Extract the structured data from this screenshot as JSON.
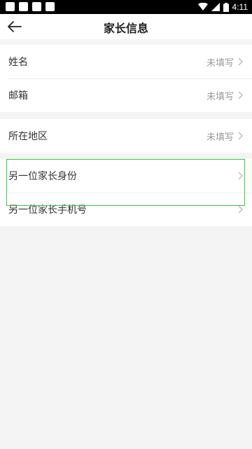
{
  "status_bar": {
    "time": "4:11",
    "icons": [
      "notification-icon",
      "notification-icon",
      "notification-icon",
      "notification-icon",
      "wifi-icon",
      "signal-icon",
      "battery-icon"
    ]
  },
  "header": {
    "title": "家长信息",
    "back_icon": "arrow-left-icon"
  },
  "sections": [
    {
      "rows": [
        {
          "label": "姓名",
          "value": "未填写"
        },
        {
          "label": "邮箱",
          "value": "未填写"
        }
      ]
    },
    {
      "rows": [
        {
          "label": "所在地区",
          "value": "未填写"
        }
      ]
    },
    {
      "rows": [
        {
          "label": "另一位家长身份",
          "value": ""
        },
        {
          "label": "另一位家长手机号",
          "value": ""
        }
      ]
    }
  ],
  "colors": {
    "highlight_border": "#3cc83c",
    "background": "#f4f4f4"
  }
}
